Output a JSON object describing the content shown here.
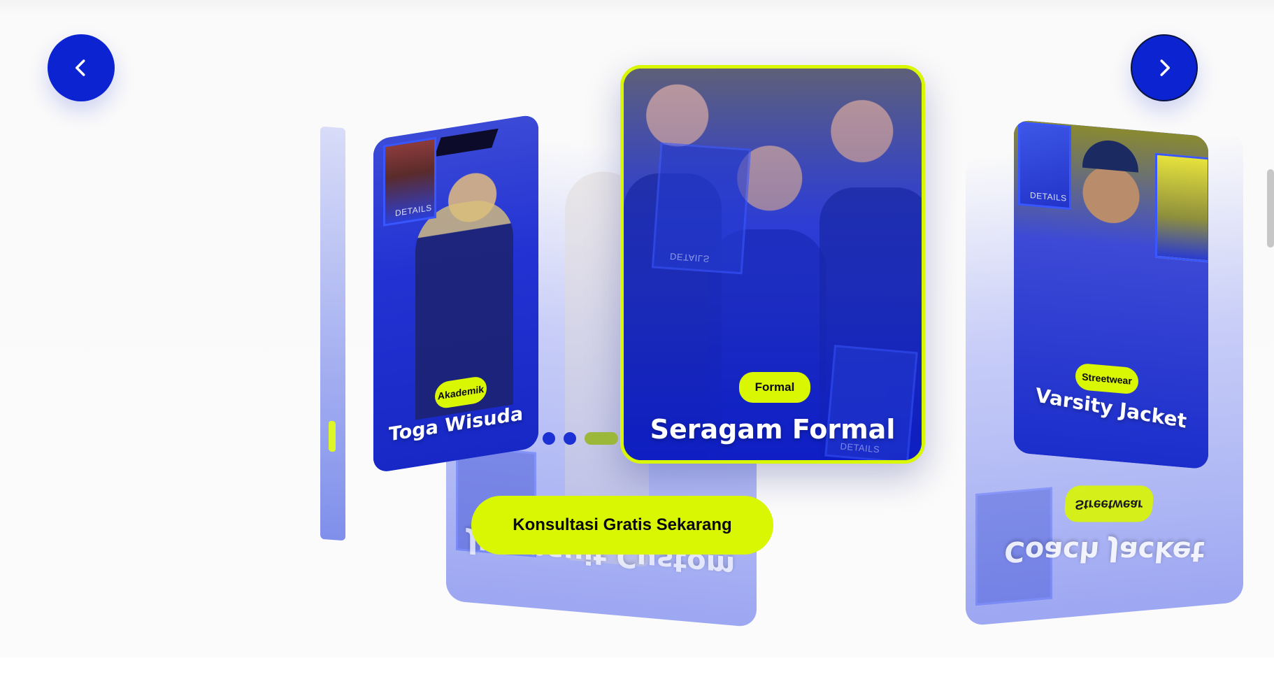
{
  "carousel": {
    "prev_label": "Previous",
    "next_label": "Next",
    "details_label": "DETAILS",
    "cards": [
      {
        "tag": "Akademik",
        "title": "Toga Wisuda"
      },
      {
        "tag": "Formal",
        "title": "Seragam Formal"
      },
      {
        "tag": "Streetwear",
        "title": "Varsity Jacket"
      },
      {
        "tag": "Streetwear",
        "title": "Coach Jacket"
      },
      {
        "tag": "",
        "title": "Jumpsuit Custom"
      }
    ],
    "pagination": {
      "count": 3,
      "active": 3
    }
  },
  "cta": {
    "label": "Konsultasi Gratis Sekarang"
  },
  "colors": {
    "primary": "#0c23d2",
    "accent": "#d9f603"
  }
}
